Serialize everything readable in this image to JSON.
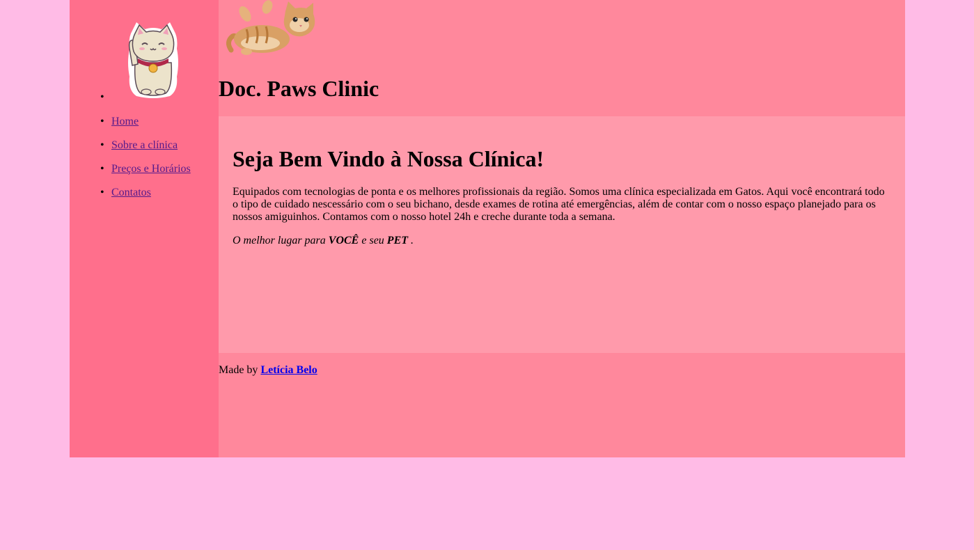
{
  "site": {
    "title": "Doc. Paws Clinic"
  },
  "sidebar": {
    "logo_icon": "lucky-cat-icon",
    "items": [
      {
        "label": "Home"
      },
      {
        "label": "Sobre a clínica"
      },
      {
        "label": "Preços e Horários"
      },
      {
        "label": "Contatos"
      }
    ]
  },
  "header": {
    "image_icon": "kitten-photo"
  },
  "main": {
    "heading": "Seja Bem Vindo à Nossa Clínica!",
    "intro": "Equipados com tecnologias de ponta e os melhores profissionais da região. Somos uma clínica especializada em Gatos. Aqui você encontrará todo o tipo de cuidado nescessário com o seu bichano, desde exames de rotina até emergências, além de contar com o nosso espaço planejado para os nossos amiguinhos. Contamos com o nosso hotel 24h e creche durante toda a semana.",
    "slogan_part1": "O melhor lugar para ",
    "slogan_strong1": "VOCÊ",
    "slogan_part2": " e seu ",
    "slogan_strong2": "PET",
    "slogan_part3": " ."
  },
  "footer": {
    "prefix": "Made by ",
    "author": "Letícia Belo"
  },
  "colors": {
    "background": "#ffbbe6",
    "sidebar": "#ff6f8c",
    "header_footer": "#ff889c",
    "main": "#ff9aab",
    "visited_link": "#551a8b",
    "link": "#0000ee"
  }
}
